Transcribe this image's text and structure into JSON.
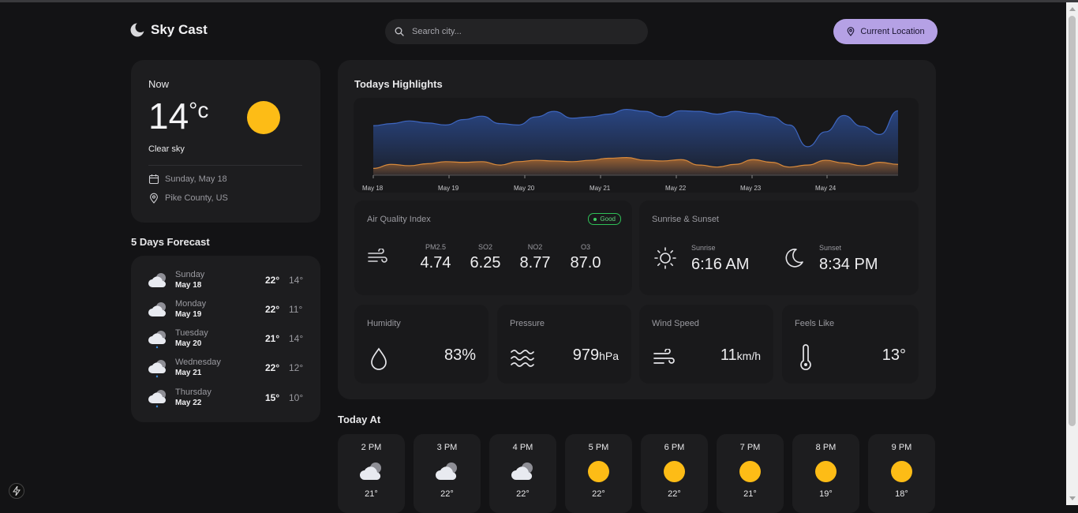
{
  "header": {
    "app_name": "Sky Cast",
    "search_placeholder": "Search city...",
    "location_button": "Current Location"
  },
  "now": {
    "label": "Now",
    "temperature": "14",
    "unit": "°c",
    "condition": "Clear sky",
    "date": "Sunday, May 18",
    "location": "Pike County, US",
    "sun_color": "#fdbc16"
  },
  "forecast": {
    "title": "5 Days Forecast",
    "days": [
      {
        "day": "Sunday",
        "date": "May 18",
        "high": "22°",
        "low": "14°",
        "icon": "cloudy-icon"
      },
      {
        "day": "Monday",
        "date": "May 19",
        "high": "22°",
        "low": "11°",
        "icon": "cloudy-icon"
      },
      {
        "day": "Tuesday",
        "date": "May 20",
        "high": "21°",
        "low": "14°",
        "icon": "rain-icon"
      },
      {
        "day": "Wednesday",
        "date": "May 21",
        "high": "22°",
        "low": "12°",
        "icon": "rain-icon"
      },
      {
        "day": "Thursday",
        "date": "May 22",
        "high": "15°",
        "low": "10°",
        "icon": "rain-icon"
      }
    ]
  },
  "highlights": {
    "title": "Todays Highlights",
    "aqi": {
      "label": "Air Quality Index",
      "badge": "Good",
      "items": [
        {
          "key": "PM2.5",
          "value": "4.74"
        },
        {
          "key": "SO2",
          "value": "6.25"
        },
        {
          "key": "NO2",
          "value": "8.77"
        },
        {
          "key": "O3",
          "value": "87.0"
        }
      ]
    },
    "sun": {
      "label": "Sunrise & Sunset",
      "sunrise_label": "Sunrise",
      "sunrise": "6:16 AM",
      "sunset_label": "Sunset",
      "sunset": "8:34 PM"
    },
    "humidity": {
      "label": "Humidity",
      "value": "83%"
    },
    "pressure": {
      "label": "Pressure",
      "value": "979",
      "unit": "hPa"
    },
    "wind": {
      "label": "Wind Speed",
      "value": "11",
      "unit": "km/h"
    },
    "feels": {
      "label": "Feels Like",
      "value": "13°"
    }
  },
  "chart_data": {
    "type": "area",
    "x_ticks": [
      "May 18",
      "May 19",
      "May 20",
      "May 21",
      "May 22",
      "May 23",
      "May 24"
    ],
    "series": [
      {
        "color": "#2c4d94",
        "values": [
          0.73,
          0.76,
          0.8,
          0.77,
          0.74,
          0.82,
          0.87,
          0.76,
          0.74,
          0.86,
          0.94,
          0.84,
          0.86,
          0.9,
          0.97,
          0.94,
          0.86,
          0.95,
          0.94,
          0.9,
          0.94,
          0.91,
          0.86,
          0.74,
          0.42,
          0.64,
          0.88,
          0.72,
          0.6,
          0.95
        ]
      },
      {
        "color": "#b06a2c",
        "values": [
          0.1,
          0.16,
          0.14,
          0.17,
          0.2,
          0.19,
          0.2,
          0.15,
          0.2,
          0.22,
          0.21,
          0.2,
          0.22,
          0.25,
          0.26,
          0.22,
          0.21,
          0.23,
          0.15,
          0.12,
          0.16,
          0.23,
          0.19,
          0.12,
          0.15,
          0.22,
          0.18,
          0.14,
          0.19,
          0.16
        ]
      }
    ],
    "grid": false
  },
  "today": {
    "title": "Today At",
    "hours": [
      {
        "time": "2 PM",
        "temp": "21°",
        "icon": "cloudy-icon"
      },
      {
        "time": "3 PM",
        "temp": "22°",
        "icon": "cloudy-icon"
      },
      {
        "time": "4 PM",
        "temp": "22°",
        "icon": "cloudy-icon"
      },
      {
        "time": "5 PM",
        "temp": "22°",
        "icon": "sun-icon"
      },
      {
        "time": "6 PM",
        "temp": "22°",
        "icon": "sun-icon"
      },
      {
        "time": "7 PM",
        "temp": "21°",
        "icon": "sun-icon"
      },
      {
        "time": "8 PM",
        "temp": "19°",
        "icon": "sun-icon"
      },
      {
        "time": "9 PM",
        "temp": "18°",
        "icon": "sun-icon"
      }
    ]
  }
}
